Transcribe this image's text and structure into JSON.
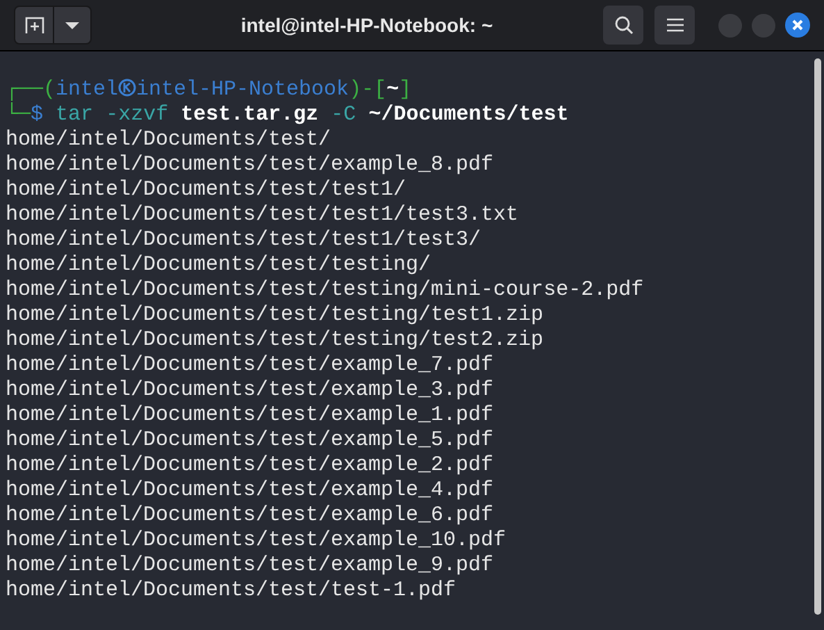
{
  "window": {
    "title": "intel@intel-HP-Notebook: ~"
  },
  "prompt": {
    "line_1": [
      {
        "text": "┌──(",
        "kind": "frame"
      },
      {
        "text": "intel",
        "kind": "user"
      },
      {
        "text": "intel-HP-Notebook",
        "kind": "host"
      },
      {
        "text": ")-[",
        "kind": "frame"
      },
      {
        "text": "~",
        "kind": "path"
      },
      {
        "text": "]",
        "kind": "frame"
      }
    ],
    "line_2": [
      {
        "text": "└─",
        "kind": "frame"
      },
      {
        "text": "$",
        "kind": "symbol"
      },
      {
        "text": "tar",
        "kind": "command"
      },
      {
        "text": "-xzvf",
        "kind": "option"
      },
      {
        "text": "test.tar.gz",
        "kind": "argument"
      },
      {
        "text": "-C",
        "kind": "option"
      },
      {
        "text": "~/Documents/test",
        "kind": "argument"
      }
    ]
  },
  "output": [
    "home/intel/Documents/test/",
    "home/intel/Documents/test/example_8.pdf",
    "home/intel/Documents/test/test1/",
    "home/intel/Documents/test/test1/test3.txt",
    "home/intel/Documents/test/test1/test3/",
    "home/intel/Documents/test/testing/",
    "home/intel/Documents/test/testing/mini-course-2.pdf",
    "home/intel/Documents/test/testing/test1.zip",
    "home/intel/Documents/test/testing/test2.zip",
    "home/intel/Documents/test/example_7.pdf",
    "home/intel/Documents/test/example_3.pdf",
    "home/intel/Documents/test/example_1.pdf",
    "home/intel/Documents/test/example_5.pdf",
    "home/intel/Documents/test/example_2.pdf",
    "home/intel/Documents/test/example_4.pdf",
    "home/intel/Documents/test/example_6.pdf",
    "home/intel/Documents/test/example_10.pdf",
    "home/intel/Documents/test/example_9.pdf",
    "home/intel/Documents/test/test-1.pdf"
  ]
}
